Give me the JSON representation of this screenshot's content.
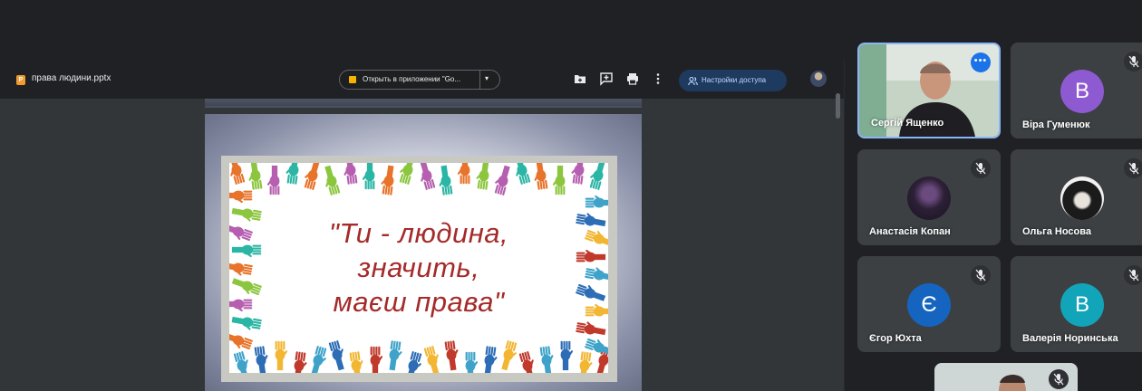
{
  "viewer": {
    "file_name": "права людини.pptx",
    "file_icon_letter": "P",
    "open_button_label": "Открыть в приложении \"Go...",
    "access_button_label": "Настройки доступа",
    "toolbar_icons": [
      "add-to-drive-icon",
      "add-comment-icon",
      "print-icon",
      "more-vert-icon"
    ]
  },
  "slide": {
    "lines": [
      "\"Ти - людина,",
      "значить,",
      "маєш права\""
    ],
    "text_color": "#a52a2a"
  },
  "participants": [
    {
      "name": "Сергій Ященко",
      "type": "video",
      "muted": false,
      "active": true
    },
    {
      "name": "Віра Гуменюк",
      "type": "letter",
      "letter": "В",
      "color": "#8e5ad1",
      "muted": true
    },
    {
      "name": "Анастасія Копан",
      "type": "photo",
      "muted": true
    },
    {
      "name": "Ольга Носова",
      "type": "photo",
      "muted": true
    },
    {
      "name": "Єгор Юхта",
      "type": "letter",
      "letter": "Є",
      "color": "#1565c0",
      "muted": true
    },
    {
      "name": "Валерія Норинська",
      "type": "letter",
      "letter": "В",
      "color": "#12a4b8",
      "muted": true
    }
  ],
  "colors": {
    "background": "#202124",
    "tile": "#3c4043",
    "active_border": "#8ab4f8",
    "accent": "#1a73e8"
  }
}
